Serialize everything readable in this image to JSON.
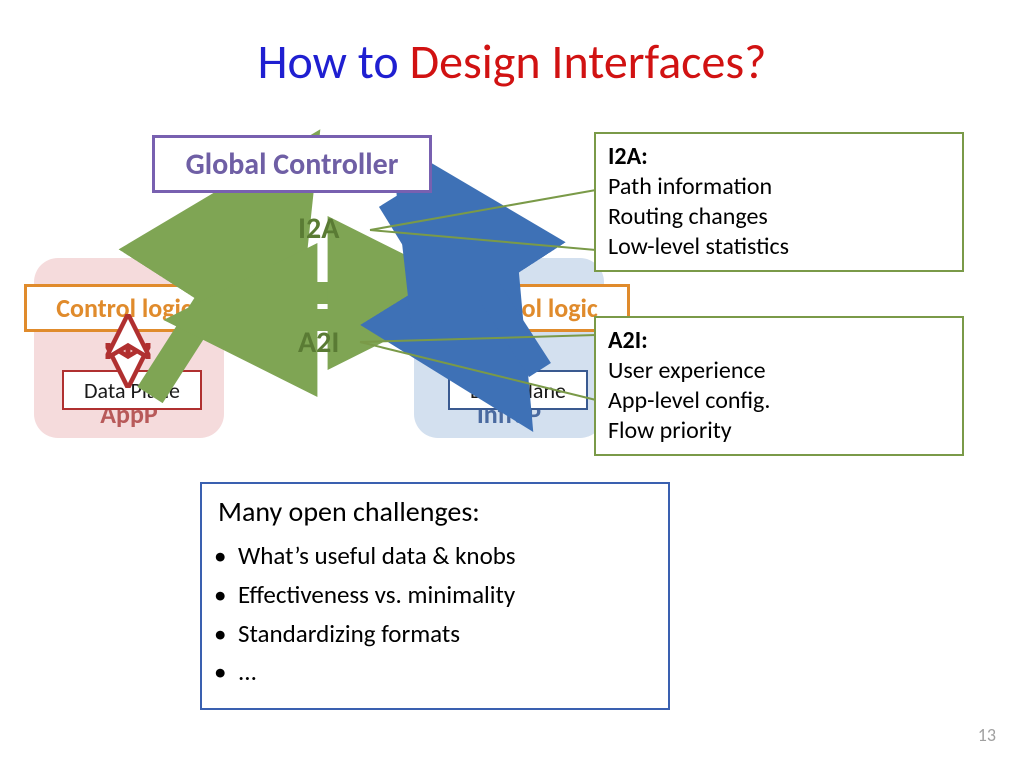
{
  "title": {
    "part1": "How to ",
    "part2": "Design Interfaces",
    "part3": "?"
  },
  "global_controller": "Global Controller",
  "labels": {
    "i2a": "I2A",
    "a2i": "A2I"
  },
  "left": {
    "control_logic": "Control logic",
    "data_plane": "Data Plane",
    "name": "AppP"
  },
  "right": {
    "control_logic": "Control logic",
    "data_plane": "Data Plane",
    "name": "InfraP"
  },
  "callout_i2a": {
    "head": "I2A:",
    "l1": "Path information",
    "l2": "Routing changes",
    "l3": "Low-level statistics"
  },
  "callout_a2i": {
    "head": "A2I:",
    "l1": "User experience",
    "l2": "App-level config.",
    "l3": "Flow priority"
  },
  "challenges": {
    "head": "Many open challenges:",
    "b1": "What’s useful data & knobs",
    "b2": "Effectiveness vs. minimality",
    "b3": "Standardizing formats",
    "b4": "..."
  },
  "page_number": "13"
}
